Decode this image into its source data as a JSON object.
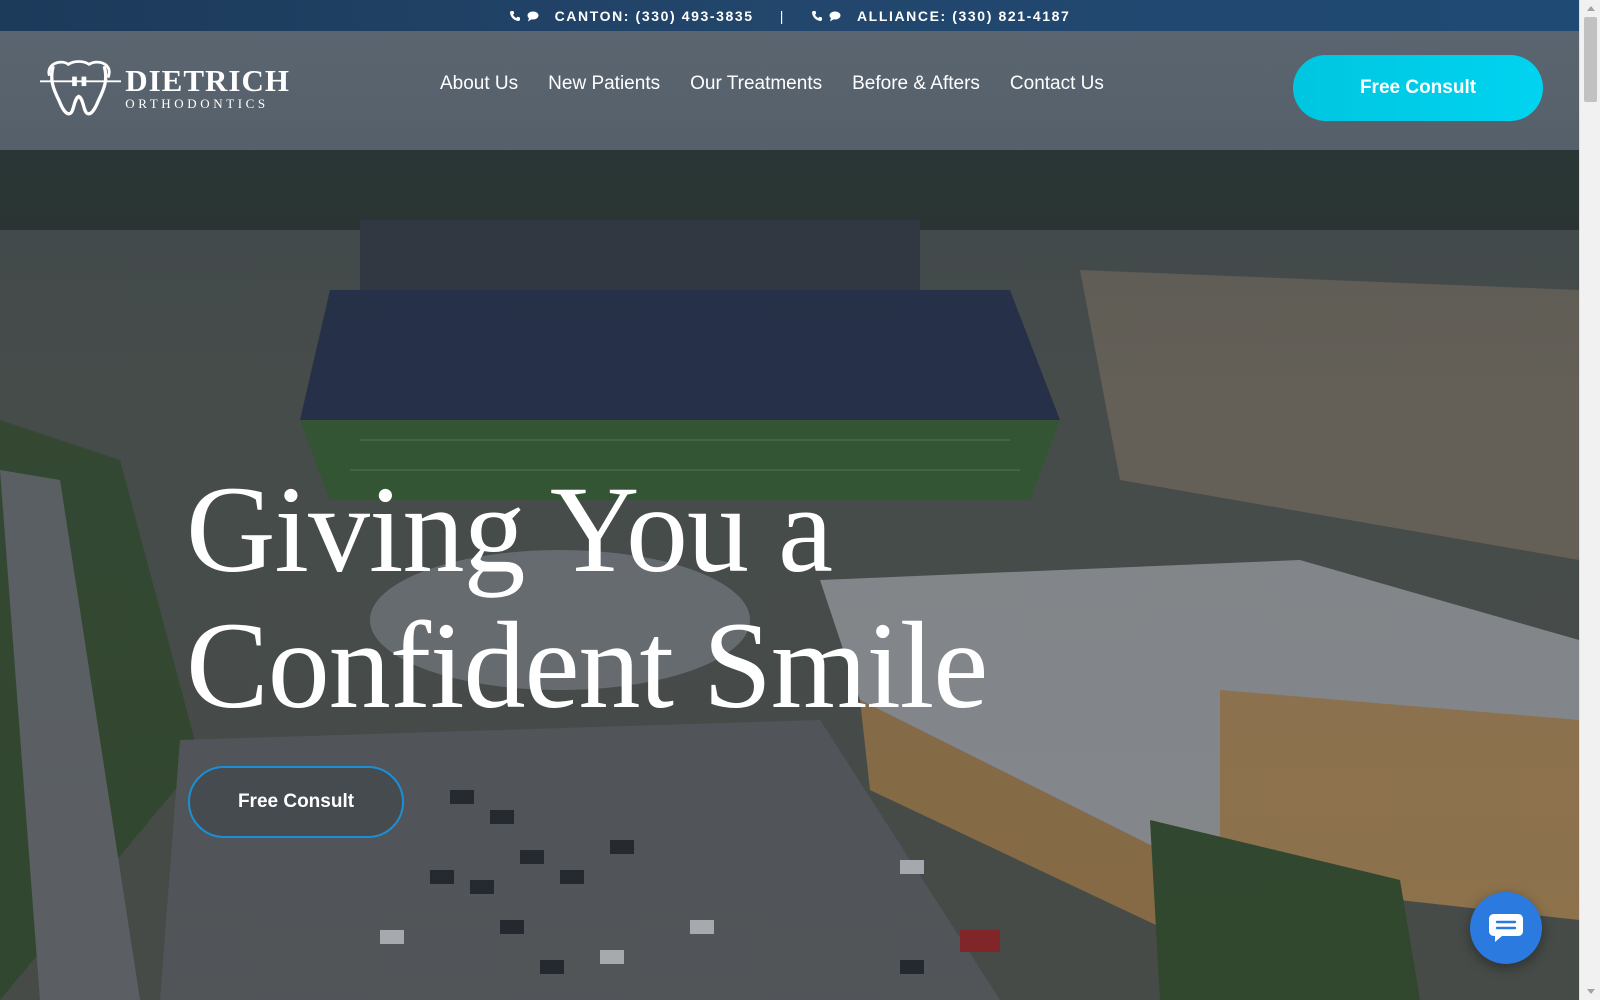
{
  "topbar": {
    "canton": {
      "label": "CANTON: (330) 493-3835",
      "icons": [
        "phone-icon",
        "chat-bubble-icon"
      ]
    },
    "separator": "|",
    "alliance": {
      "label": "ALLIANCE: (330) 821-4187",
      "icons": [
        "phone-icon",
        "chat-bubble-icon"
      ]
    }
  },
  "brand": {
    "name": "DIETRICH",
    "subtitle": "ORTHODONTICS",
    "logo_icon": "tooth-with-braces-icon"
  },
  "nav": {
    "items": [
      {
        "label": "About Us"
      },
      {
        "label": "New Patients"
      },
      {
        "label": "Our Treatments"
      },
      {
        "label": "Before & Afters"
      },
      {
        "label": "Contact Us"
      }
    ]
  },
  "header_cta": {
    "label": "Free Consult"
  },
  "hero": {
    "title_line1": "Giving You a",
    "title_line2": "Confident Smile",
    "cta_label": "Free Consult",
    "background": "aerial-stadium-photo"
  },
  "chat_widget": {
    "icon": "chat-icon"
  },
  "colors": {
    "topbar": "#1f4568",
    "accent_cyan": "#00ccea",
    "hero_button_border": "#1b8fd6",
    "chat_button": "#2a7ae0",
    "text": "#ffffff"
  }
}
